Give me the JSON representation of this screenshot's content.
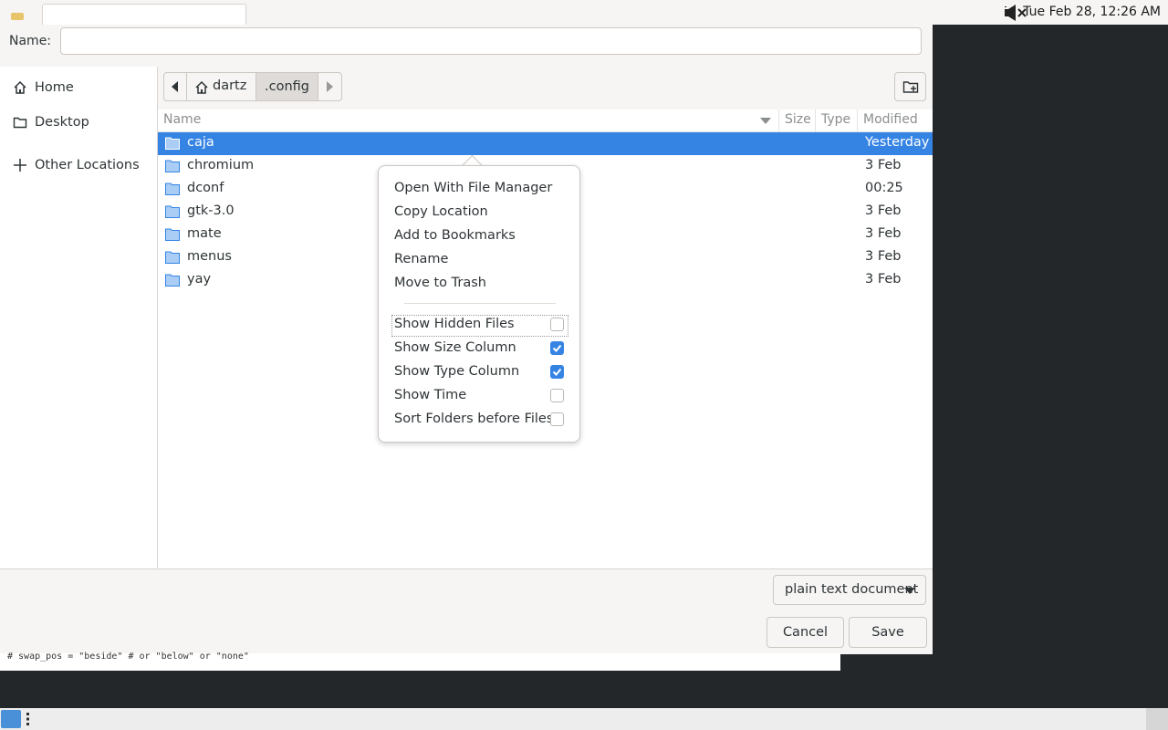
{
  "topbar": {
    "clock": "Tue Feb 28, 12:26 AM",
    "volume_icon": "speaker-muted-icon"
  },
  "dialog": {
    "name_label": "Name:",
    "name_value": "",
    "sidebar": {
      "items": [
        {
          "label": "Home",
          "icon": "home-icon"
        },
        {
          "label": "Desktop",
          "icon": "folder-icon"
        },
        {
          "label": "Other Locations",
          "icon": "plus-icon"
        }
      ]
    },
    "pathbar": {
      "home_label": "dartz",
      "current_label": ".config"
    },
    "columns": {
      "name": "Name",
      "size": "Size",
      "type": "Type",
      "modified": "Modified"
    },
    "files": [
      {
        "name": "caja",
        "modified": "Yesterday",
        "selected": true
      },
      {
        "name": "chromium",
        "modified": "3 Feb"
      },
      {
        "name": "dconf",
        "modified": "00:25"
      },
      {
        "name": "gtk-3.0",
        "modified": "3 Feb"
      },
      {
        "name": "mate",
        "modified": "3 Feb"
      },
      {
        "name": "menus",
        "modified": "3 Feb"
      },
      {
        "name": "yay",
        "modified": "3 Feb"
      }
    ],
    "filter": "plain text document",
    "cancel_label": "Cancel",
    "save_label": "Save"
  },
  "context_menu": {
    "actions": [
      "Open With File Manager",
      "Copy Location",
      "Add to Bookmarks",
      "Rename",
      "Move to Trash"
    ],
    "toggles": [
      {
        "label": "Show Hidden Files",
        "checked": false
      },
      {
        "label": "Show Size Column",
        "checked": true
      },
      {
        "label": "Show Type Column",
        "checked": true
      },
      {
        "label": "Show Time",
        "checked": false
      },
      {
        "label": "Sort Folders before Files",
        "checked": false
      }
    ]
  },
  "terminal": {
    "line": "# swap_pos = \"beside\" # or \"below\" or \"none\""
  },
  "colors": {
    "accent": "#3584e4",
    "window_bg": "#f6f5f4",
    "desktop_bg": "#23272a"
  }
}
